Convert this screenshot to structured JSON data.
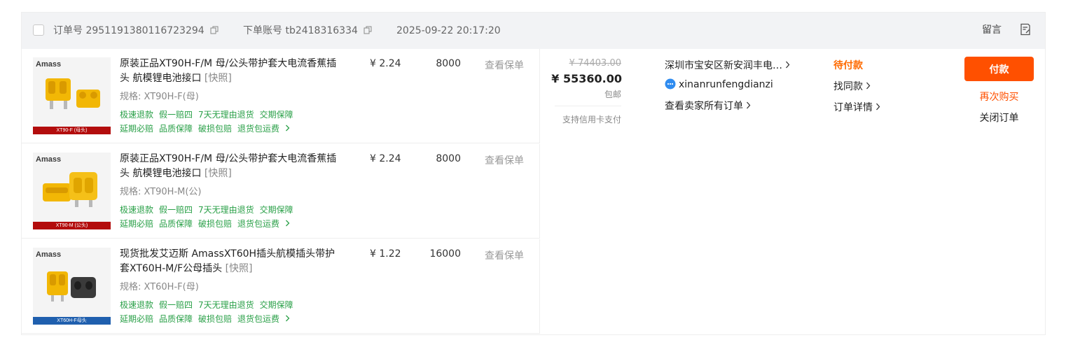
{
  "header": {
    "order_no_label": "订单号",
    "order_no": "2951191380116723294",
    "account_label": "下单账号",
    "account": "tb2418316334",
    "datetime": "2025-09-22 20:17:20",
    "message_label": "留言"
  },
  "products": [
    {
      "brand": "Amass",
      "image_caption": "XT90-F (母头)",
      "title": "原装正品XT90H-F/M 母/公头带护套大电流香蕉插头 航模锂电池接口",
      "snapshot": "[快照]",
      "spec": "规格: XT90H-F(母)",
      "services_row1": [
        "极速退款",
        "假一赔四",
        "7天无理由退货",
        "交期保障"
      ],
      "services_row2": [
        "延期必赔",
        "品质保障",
        "破损包赔",
        "退货包运费"
      ],
      "price": "¥ 2.24",
      "quantity": "8000",
      "policy": "查看保单"
    },
    {
      "brand": "Amass",
      "image_caption": "XT90-M (公头)",
      "title": "原装正品XT90H-F/M 母/公头带护套大电流香蕉插头 航模锂电池接口",
      "snapshot": "[快照]",
      "spec": "规格: XT90H-M(公)",
      "services_row1": [
        "极速退款",
        "假一赔四",
        "7天无理由退货",
        "交期保障"
      ],
      "services_row2": [
        "延期必赔",
        "品质保障",
        "破损包赔",
        "退货包运费"
      ],
      "price": "¥ 2.24",
      "quantity": "8000",
      "policy": "查看保单"
    },
    {
      "brand": "Amass",
      "image_caption": "XT60H-F母头",
      "title": "现货批发艾迈斯 AmassXT60H插头航模插头带护套XT60H-M/F公母插头",
      "snapshot": "[快照]",
      "spec": "规格: XT60H-F(母)",
      "services_row1": [
        "极速退款",
        "假一赔四",
        "7天无理由退货",
        "交期保障"
      ],
      "services_row2": [
        "延期必赔",
        "品质保障",
        "破损包赔",
        "退货包运费"
      ],
      "price": "¥ 1.22",
      "quantity": "16000",
      "policy": "查看保单"
    }
  ],
  "amount": {
    "original": "¥ 74403.00",
    "total": "¥ 55360.00",
    "shipping": "包邮",
    "credit_card": "支持信用卡支付"
  },
  "seller": {
    "address": "深圳市宝安区新安润丰电…",
    "name": "xinanrunfengdianzi",
    "all_orders": "查看卖家所有订单"
  },
  "status": {
    "text": "待付款",
    "find_similar": "找同款",
    "order_detail": "订单详情"
  },
  "actions": {
    "pay": "付款",
    "rebuy": "再次购买",
    "close": "关闭订单"
  },
  "colors": {
    "accent": "#ff5000",
    "status": "#ff6a00",
    "service_green": "#2aa048",
    "header_bg": "#f2f3f5",
    "caption_red": "#b30d0d",
    "caption_blue": "#1f5fae"
  },
  "icons": {
    "copy": "copy-icon",
    "note": "note-icon",
    "chevron": "chevron-right-icon",
    "chat": "chat-bubble-icon"
  }
}
